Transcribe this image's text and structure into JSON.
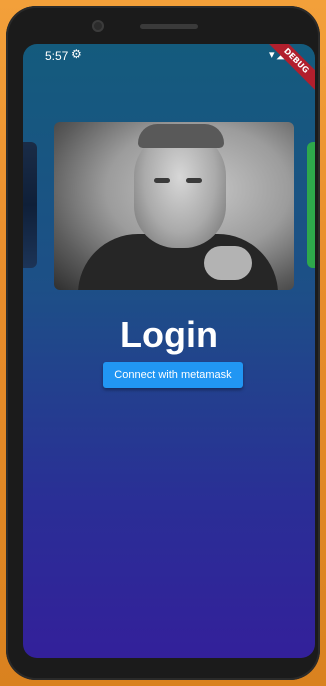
{
  "status_bar": {
    "time": "5:57",
    "settings_icon": "gear-icon",
    "right_icons": [
      "wifi-icon",
      "signal-icon",
      "battery-icon"
    ],
    "debug_banner": "DEBUG"
  },
  "screen": {
    "title": "Login",
    "connect_button_label": "Connect with metamask",
    "button_color": "#2196f3",
    "background_gradient": [
      "#145b7d",
      "#33209a"
    ]
  }
}
